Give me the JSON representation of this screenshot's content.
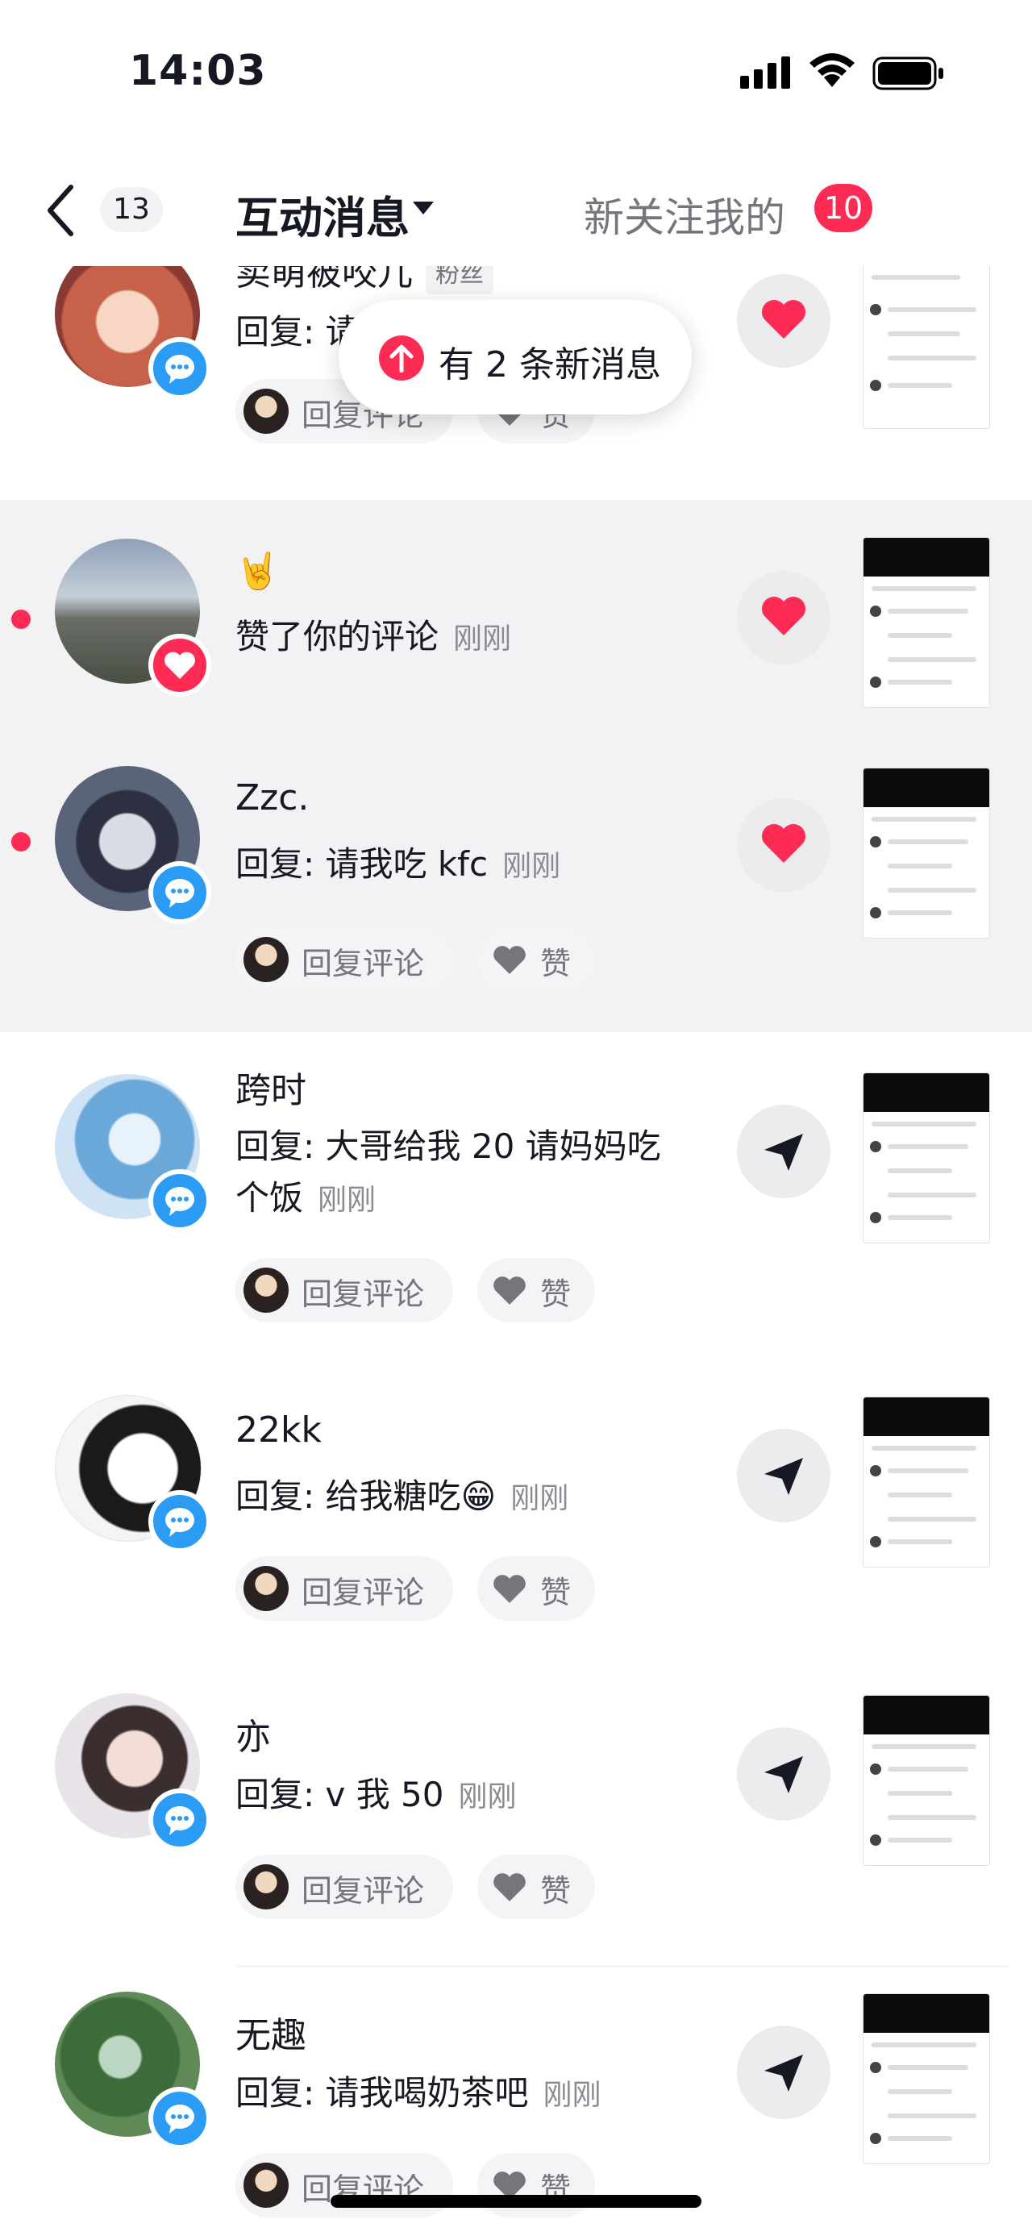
{
  "status_bar": {
    "time": "14:03"
  },
  "nav": {
    "back_count": "13",
    "title": "互动消息",
    "right_label": "新关注我的",
    "right_badge": "10"
  },
  "toast": {
    "text": "有 2 条新消息"
  },
  "common": {
    "reply_label": "回复评论",
    "like_label": "赞"
  },
  "items": [
    {
      "name": "卖萌被咬儿",
      "tag": "粉丝",
      "message": "回复: 请",
      "time": ""
    },
    {
      "name": "🤘",
      "message": "赞了你的评论",
      "time": "刚刚"
    },
    {
      "name": "Zzc.",
      "message": "回复: 请我吃 kfc",
      "time": "刚刚"
    },
    {
      "name": "跨时",
      "message": "回复: 大哥给我 20 请妈妈吃个饭",
      "time": "刚刚"
    },
    {
      "name": "22kk",
      "message": "回复: 给我糖吃😁",
      "time": "刚刚"
    },
    {
      "name": "亦",
      "message": "回复: v 我 50",
      "time": "刚刚"
    },
    {
      "name": "无趣",
      "message": "回复: 请我喝奶茶吧",
      "time": "刚刚"
    }
  ],
  "colors": {
    "accent": "#fe2c55",
    "badge_blue": "#2a9cf5",
    "unread_bg": "#f2f2f4"
  }
}
